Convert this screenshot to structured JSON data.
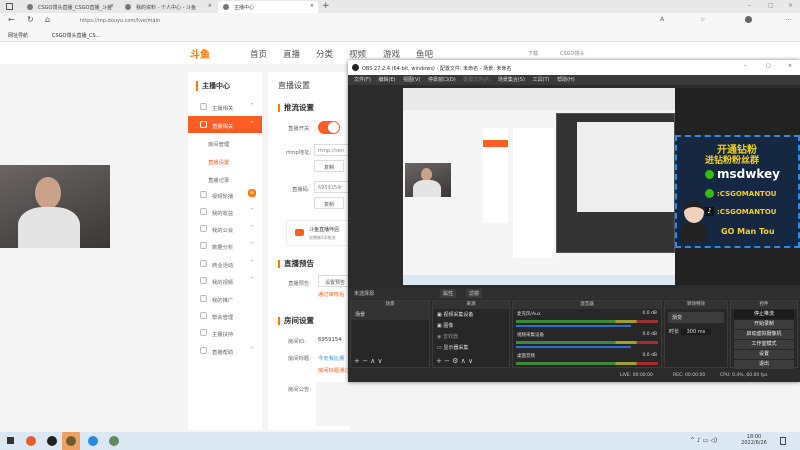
{
  "browser": {
    "tabs": [
      {
        "label": "CSGO馒头直播_CSGO直播_斗鱼"
      },
      {
        "label": "我的资料 - 个人中心 - 斗鱼"
      },
      {
        "label": "主播中心"
      }
    ],
    "url": "https://mp.douyu.com/live/main",
    "bookmarks": [
      "网址导航",
      "CSGO馒头直播_CS..."
    ]
  },
  "douyu": {
    "logo": "斗鱼",
    "nav": [
      "首页",
      "直播",
      "分类",
      "视频",
      "游戏",
      "鱼吧"
    ],
    "download": "下载",
    "user": "CSGO馒头",
    "sidebar": {
      "title": "主播中心",
      "items": [
        {
          "label": "主播相关"
        },
        {
          "label": "直播相关"
        },
        {
          "label": "房间管理"
        },
        {
          "label": "直播设置"
        },
        {
          "label": "直播记录"
        },
        {
          "label": "视频轮播",
          "badge": "新"
        },
        {
          "label": "我的收益"
        },
        {
          "label": "我的公会"
        },
        {
          "label": "数据分析"
        },
        {
          "label": "商业活动"
        },
        {
          "label": "我的视频"
        },
        {
          "label": "我的推广"
        },
        {
          "label": "帮会管理"
        },
        {
          "label": "主播扶持"
        },
        {
          "label": "直播帮助"
        }
      ]
    },
    "main": {
      "title": "直播设置",
      "push_section": "推流设置",
      "switch_label": "直播开关:",
      "rtmp_label": "rtmp地址:",
      "rtmp_value": "rtmp://sen",
      "copy": "复制",
      "code_label": "直播码:",
      "code_value": "6959154r",
      "companion_title": "斗鱼直播伴侣",
      "companion_sub": "仅需做1次推流",
      "preview_section": "直播预告",
      "preview_label": "直播预告:",
      "preview_button": "设置预告",
      "preview_note": "通过审核后",
      "room_section": "房间设置",
      "room_id_label": "房间ID:",
      "room_id": "6959154",
      "room_title_label": "房间标题:",
      "room_title": "今天我比赛",
      "room_title_note": "房间标题通过",
      "notice_label": "房间公告:"
    }
  },
  "obs": {
    "title": "OBS 27.2.4 (64-bit, windows) - 配置文件: 未命名 - 场景: 未命名",
    "menu": [
      "文件(F)",
      "编辑(E)",
      "视图(V)",
      "停靠窗口(D)",
      "配置文件(P)",
      "场景集合(S)",
      "工具(T)",
      "帮助(H)"
    ],
    "no_source": "未选择源",
    "properties": "属性",
    "filters": "滤镜",
    "docks": {
      "scenes": {
        "title": "场景",
        "items": [
          "场景"
        ]
      },
      "sources": {
        "title": "来源",
        "items": [
          "视频采集设备",
          "图像",
          "音效器",
          "显示器采集"
        ]
      },
      "mixer": {
        "title": "混音器",
        "channels": [
          {
            "name": "麦克风/Aux",
            "db": "0.0 dB"
          },
          {
            "name": "视频采集设备",
            "db": "0.0 dB"
          },
          {
            "name": "桌面音频",
            "db": "0.0 dB"
          }
        ]
      },
      "transitions": {
        "title": "转场特效",
        "type": "渐变",
        "duration_label": "时长",
        "duration": "300 ms"
      },
      "controls": {
        "title": "控件",
        "buttons": [
          "停止推流",
          "开始录制",
          "启动虚拟摄像机",
          "工作室模式",
          "设置",
          "退出"
        ]
      }
    },
    "status": {
      "live": "LIVE: 00:00:00",
      "rec": "REC: 00:00:00",
      "cpu": "CPU: 0.4%, 60.00 fps"
    },
    "overlay": {
      "line1": "开通钻粉",
      "line2": "进钻粉粉丝群",
      "wechat": "msdwkey",
      "id1": ":CSGOMANTOU",
      "id2": ":CSGOMANTOU",
      "brand": "GO Man Tou"
    }
  },
  "taskbar": {
    "time": "18:00",
    "date": "2022/6/26"
  }
}
